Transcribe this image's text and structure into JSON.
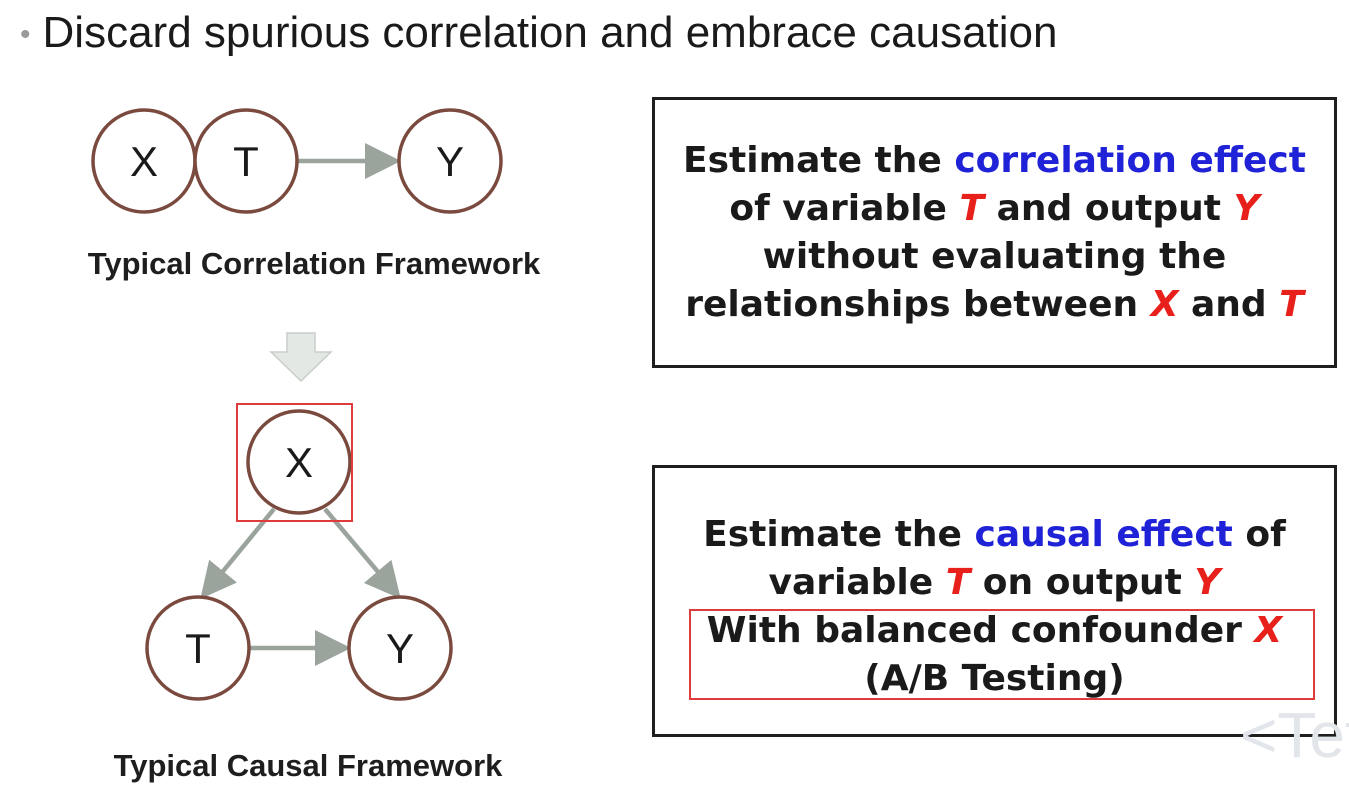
{
  "slide": {
    "bullet": "•",
    "title": "Discard spurious correlation and embrace causation"
  },
  "correlation_framework": {
    "label": "Typical Correlation Framework",
    "nodes": [
      "X",
      "T",
      "Y"
    ]
  },
  "causal_framework": {
    "label": "Typical Causal Framework",
    "nodes": [
      "X",
      "T",
      "Y"
    ]
  },
  "correlation_box": {
    "line1_a": "Estimate the ",
    "line1_b": "correlation effect",
    "line2_a": "of variable ",
    "line2_t": "T",
    "line2_b": " and output ",
    "line2_y": "Y",
    "line3": "without evaluating the",
    "line4_a": "relationships between ",
    "line4_x": "X",
    "line4_b": " and ",
    "line4_t": "T"
  },
  "causal_box": {
    "line1_a": "Estimate the ",
    "line1_b": "causal effect",
    "line1_c": " of",
    "line2_a": "variable ",
    "line2_t": "T",
    "line2_b": " on output ",
    "line2_y": "Y",
    "line3_a": "With balanced confounder ",
    "line3_x": "X",
    "line4": "(A/B Testing)"
  },
  "watermark": "<Tet",
  "colors": {
    "node_stroke": "#7b4a3f",
    "edge": "#9aa39c",
    "emphasis_blue": "#1f22d6",
    "emphasis_red": "#e8201b",
    "highlight": "#e03b3b"
  }
}
